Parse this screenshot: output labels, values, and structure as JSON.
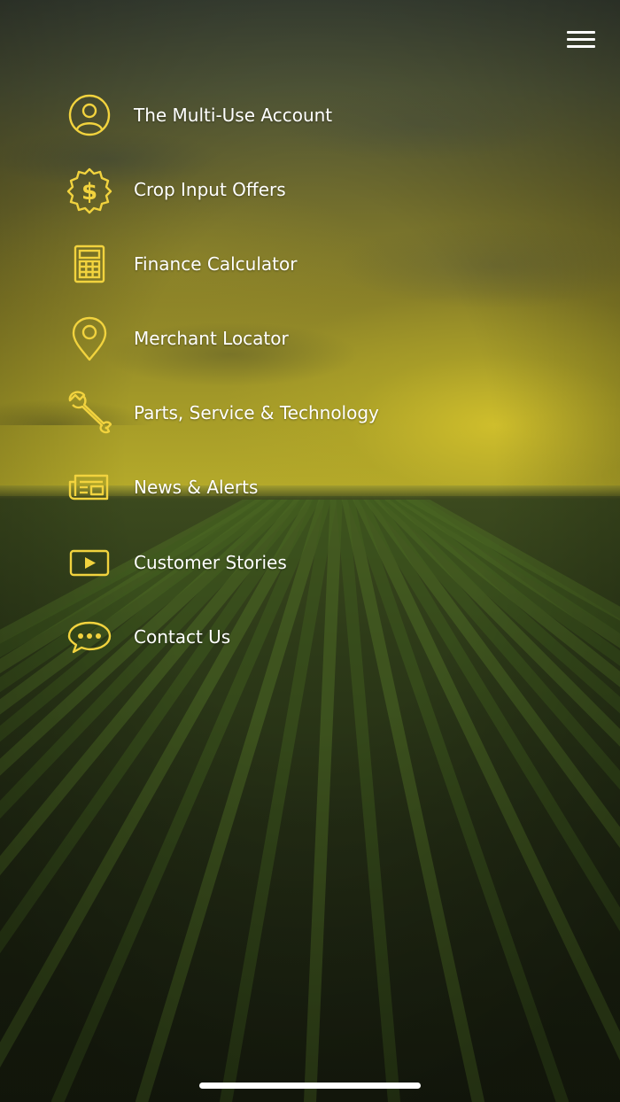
{
  "menu": {
    "items": [
      {
        "label": "The Multi-Use Account",
        "icon": "user-circle-icon"
      },
      {
        "label": "Crop Input Offers",
        "icon": "dollar-badge-icon"
      },
      {
        "label": "Finance Calculator",
        "icon": "calculator-icon"
      },
      {
        "label": "Merchant Locator",
        "icon": "map-pin-icon"
      },
      {
        "label": "Parts, Service & Technology",
        "icon": "wrench-icon"
      },
      {
        "label": "News & Alerts",
        "icon": "newspaper-icon"
      },
      {
        "label": "Customer Stories",
        "icon": "video-play-icon"
      },
      {
        "label": "Contact Us",
        "icon": "chat-bubble-icon"
      }
    ]
  },
  "colors": {
    "icon_accent": "#F2D33E",
    "label_text": "#FFFFFF"
  }
}
